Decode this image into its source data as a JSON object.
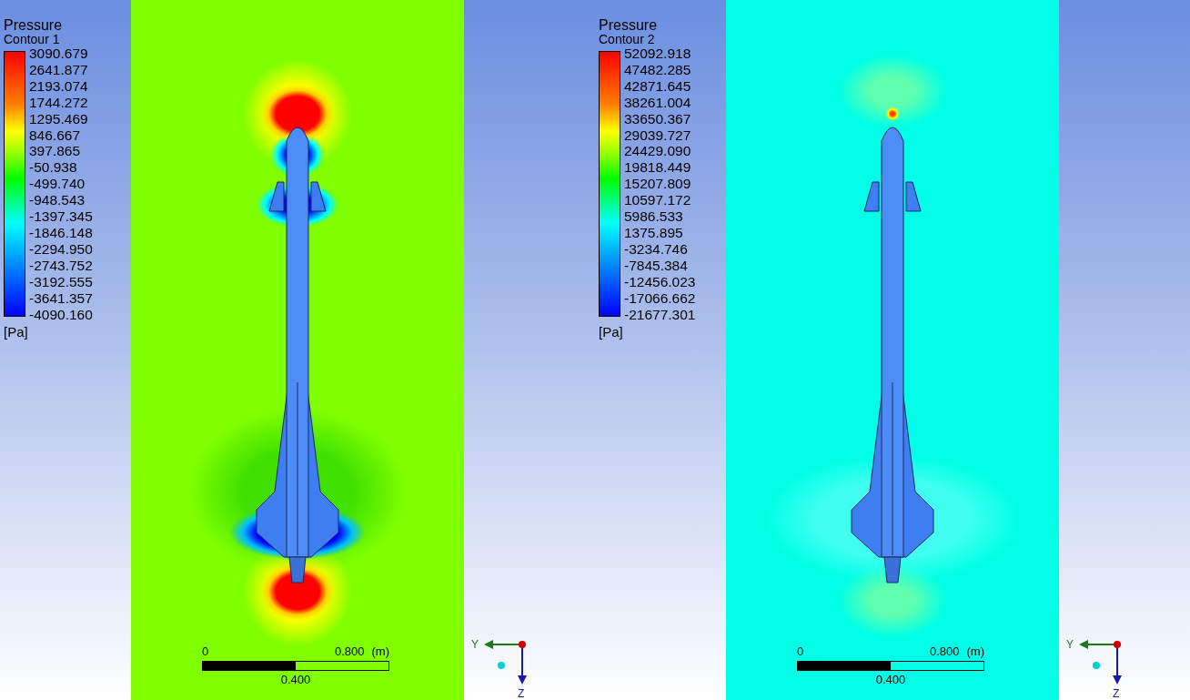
{
  "viewports": [
    {
      "legend": {
        "variable": "Pressure",
        "title": "Contour 1",
        "values": [
          "3090.679",
          "2641.877",
          "2193.074",
          "1744.272",
          "1295.469",
          "846.667",
          "397.865",
          "-50.938",
          "-499.740",
          "-948.543",
          "-1397.345",
          "-1846.148",
          "-2294.950",
          "-2743.752",
          "-3192.555",
          "-3641.357",
          "-4090.160"
        ],
        "unit": "[Pa]"
      },
      "field": {
        "color": "#80ff00",
        "kind": "strong"
      },
      "scale_bar": {
        "start": "0",
        "end": "0.800",
        "unit": "(m)",
        "middle": "0.400"
      },
      "axes": {
        "horizontal": "Y",
        "vertical": "Z"
      }
    },
    {
      "legend": {
        "variable": "Pressure",
        "title": "Contour 2",
        "values": [
          "52092.918",
          "47482.285",
          "42871.645",
          "38261.004",
          "33650.367",
          "29039.727",
          "24429.090",
          "19818.449",
          "15207.809",
          "10597.172",
          "5986.533",
          "1375.895",
          "-3234.746",
          "-7845.384",
          "-12456.023",
          "-17066.662",
          "-21677.301"
        ],
        "unit": "[Pa]"
      },
      "field": {
        "color": "#00ffe6",
        "kind": "weak"
      },
      "scale_bar": {
        "start": "0",
        "end": "0.800",
        "unit": "(m)",
        "middle": "0.400"
      },
      "axes": {
        "horizontal": "Y",
        "vertical": "Z"
      }
    }
  ]
}
